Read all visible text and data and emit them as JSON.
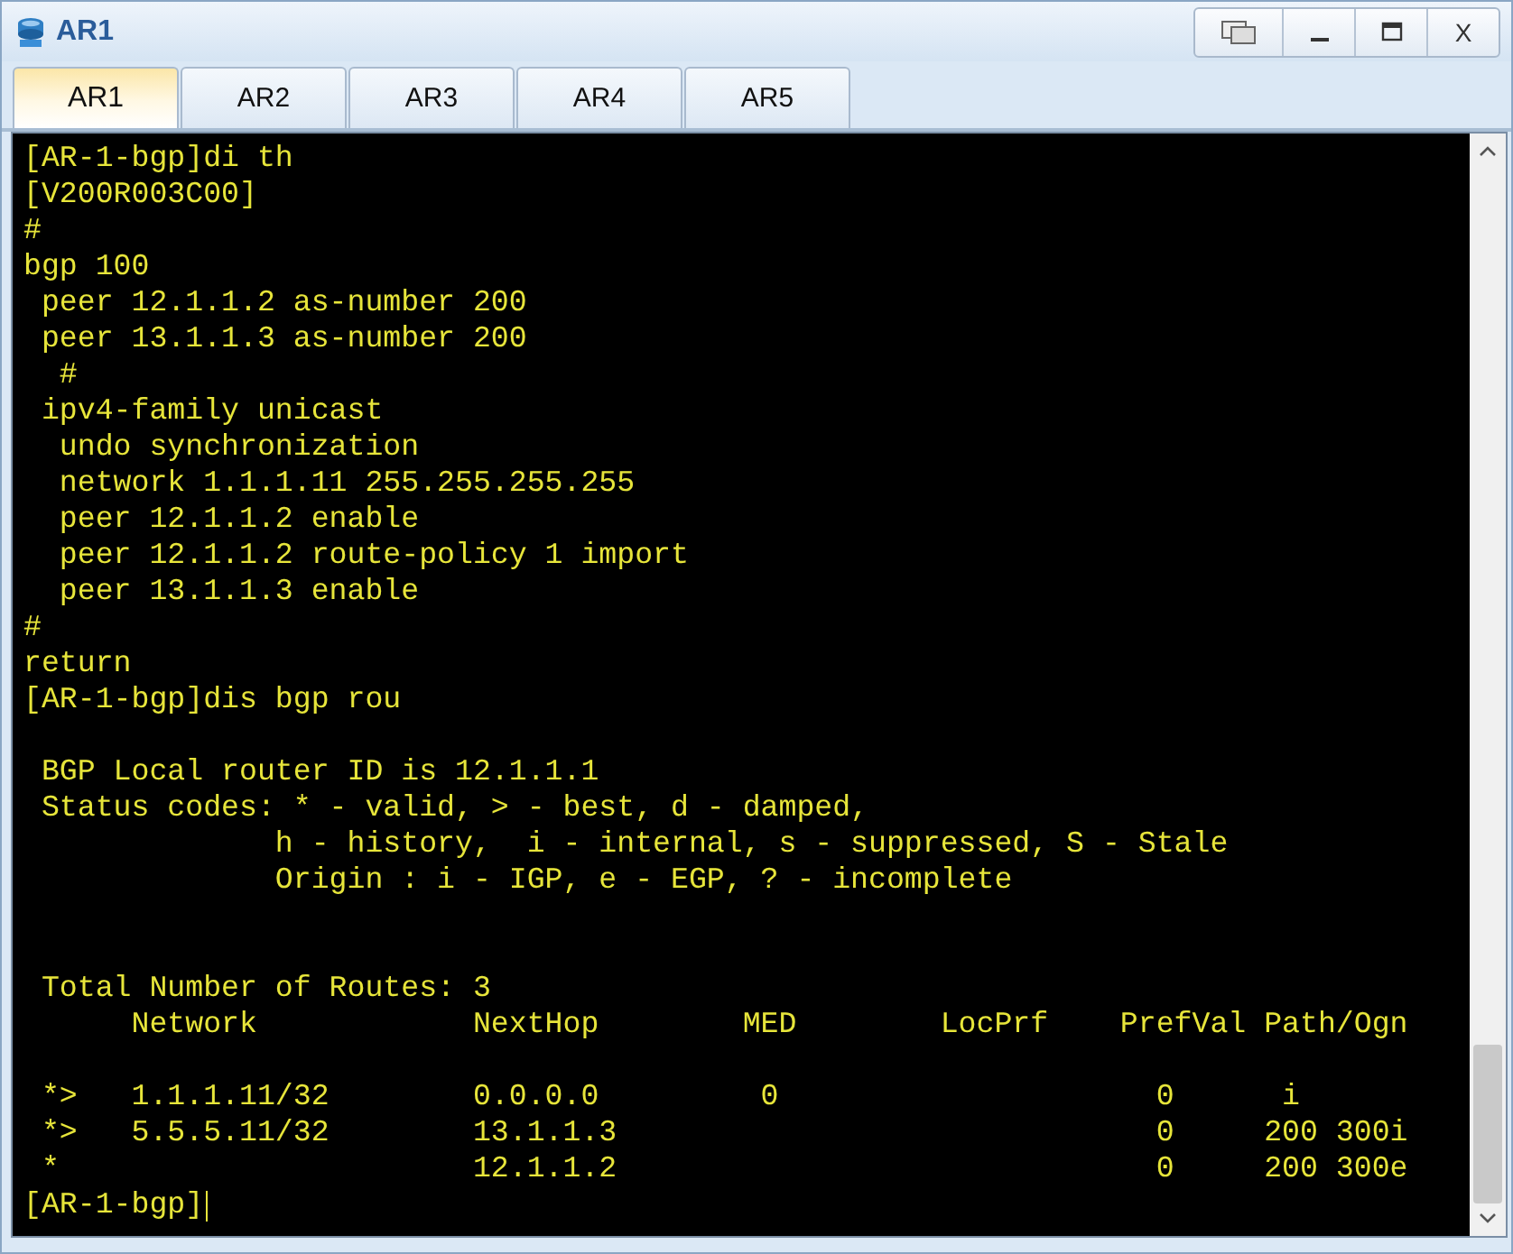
{
  "window": {
    "title": "AR1",
    "close_label": "X"
  },
  "tabs": [
    {
      "label": "AR1",
      "selected": true
    },
    {
      "label": "AR2",
      "selected": false
    },
    {
      "label": "AR3",
      "selected": false
    },
    {
      "label": "AR4",
      "selected": false
    },
    {
      "label": "AR5",
      "selected": false
    }
  ],
  "terminal": {
    "blocks": [
      [
        "[AR-1-bgp]di th",
        "[V200R003C00]",
        "#",
        "bgp 100",
        " peer 12.1.1.2 as-number 200",
        " peer 13.1.1.3 as-number 200",
        "  #",
        " ipv4-family unicast",
        "  undo synchronization",
        "  network 1.1.1.11 255.255.255.255",
        "  peer 12.1.1.2 enable",
        "  peer 12.1.1.2 route-policy 1 import",
        "  peer 13.1.1.3 enable",
        "#",
        "return",
        "[AR-1-bgp]dis bgp rou"
      ],
      [
        " BGP Local router ID is 12.1.1.1",
        " Status codes: * - valid, > - best, d - damped,",
        "              h - history,  i - internal, s - suppressed, S - Stale",
        "              Origin : i - IGP, e - EGP, ? - incomplete"
      ],
      [
        " Total Number of Routes: 3",
        "      Network            NextHop        MED        LocPrf    PrefVal Path/Ogn"
      ],
      [
        " *>   1.1.1.11/32        0.0.0.0         0                     0      i",
        " *>   5.5.5.11/32        13.1.1.3                              0     200 300i",
        " *                       12.1.1.2                              0     200 300e"
      ]
    ],
    "prompt": "[AR-1-bgp]"
  }
}
